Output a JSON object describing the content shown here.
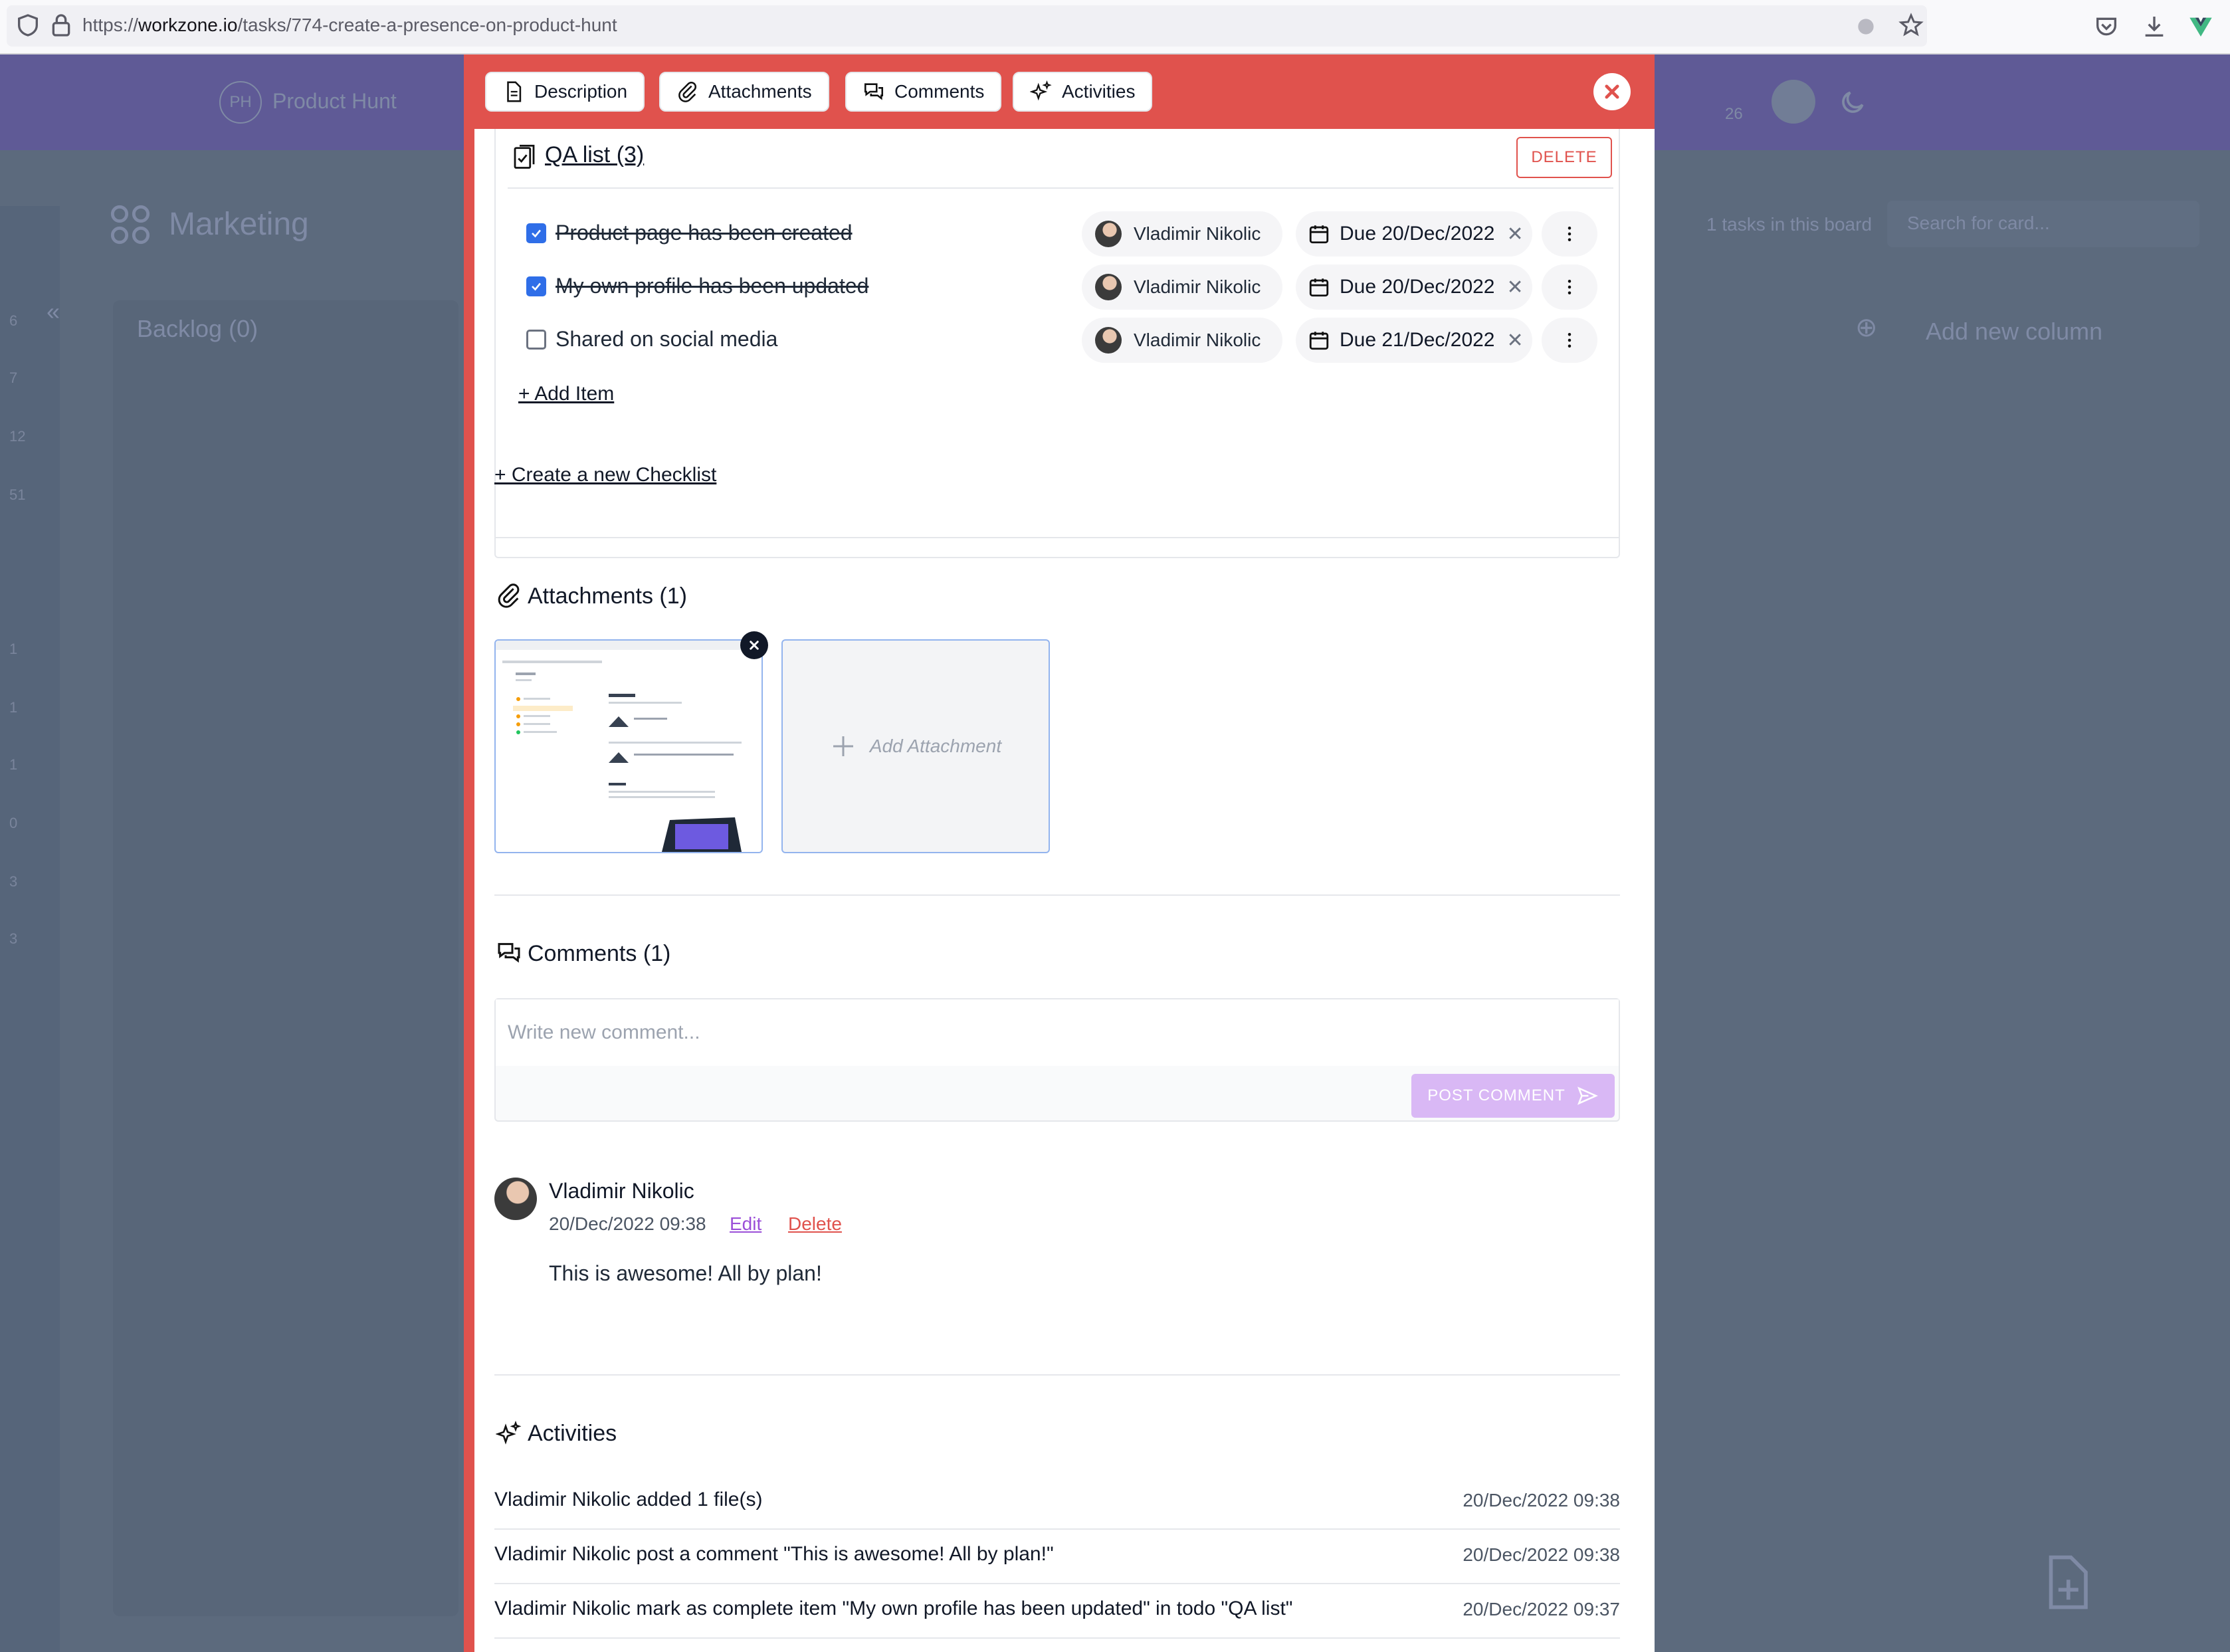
{
  "browser": {
    "url_prefix": "https://",
    "url_host": "workzone.io",
    "url_path": "/tasks/774-create-a-presence-on-product-hunt"
  },
  "background": {
    "project_name": "Product Hunt",
    "project_initials": "PH",
    "notification_count": "26",
    "board_title": "Marketing",
    "column_title": "Backlog (0)",
    "tasks_count": "1 tasks in this board",
    "search_placeholder": "Search for card...",
    "add_column": "Add new column",
    "sidebar_numbers": [
      "6",
      "7",
      "12",
      "51",
      "1",
      "1",
      "1",
      "0",
      "3",
      "3"
    ]
  },
  "tabs": [
    {
      "label": "Description",
      "icon": "document-icon"
    },
    {
      "label": "Attachments",
      "icon": "paperclip-icon"
    },
    {
      "label": "Comments",
      "icon": "chat-icon"
    },
    {
      "label": "Activities",
      "icon": "sparkles-icon"
    }
  ],
  "checklist": {
    "title": "QA list (3)",
    "delete_label": "DELETE",
    "items": [
      {
        "text": "Product page has been created",
        "done": true,
        "assignee": "Vladimir Nikolic",
        "due": "Due 20/Dec/2022"
      },
      {
        "text": "My own profile has been updated",
        "done": true,
        "assignee": "Vladimir Nikolic",
        "due": "Due 20/Dec/2022"
      },
      {
        "text": "Shared on social media",
        "done": false,
        "assignee": "Vladimir Nikolic",
        "due": "Due 21/Dec/2022"
      }
    ],
    "add_item": "+ Add Item",
    "create_checklist": "+ Create a new Checklist"
  },
  "attachments": {
    "title": "Attachments (1)",
    "add_label": "Add Attachment"
  },
  "comments": {
    "title": "Comments (1)",
    "placeholder": "Write new comment...",
    "post_label": "POST COMMENT",
    "list": [
      {
        "author": "Vladimir Nikolic",
        "timestamp": "20/Dec/2022 09:38",
        "edit": "Edit",
        "delete": "Delete",
        "body": "This is awesome! All by plan!"
      }
    ]
  },
  "activities": {
    "title": "Activities",
    "list": [
      {
        "text": "Vladimir Nikolic added 1 file(s)",
        "time": "20/Dec/2022 09:38"
      },
      {
        "text": "Vladimir Nikolic post a comment \"This is awesome! All by plan!\"",
        "time": "20/Dec/2022 09:38"
      },
      {
        "text": "Vladimir Nikolic mark as complete item \"My own profile has been updated\" in todo \"QA list\"",
        "time": "20/Dec/2022 09:37"
      }
    ]
  },
  "colors": {
    "modal_accent": "#e0524d",
    "checkbox": "#2f6ee8",
    "edit_link": "#9b4fd8",
    "post_button": "#d9b8f5"
  }
}
